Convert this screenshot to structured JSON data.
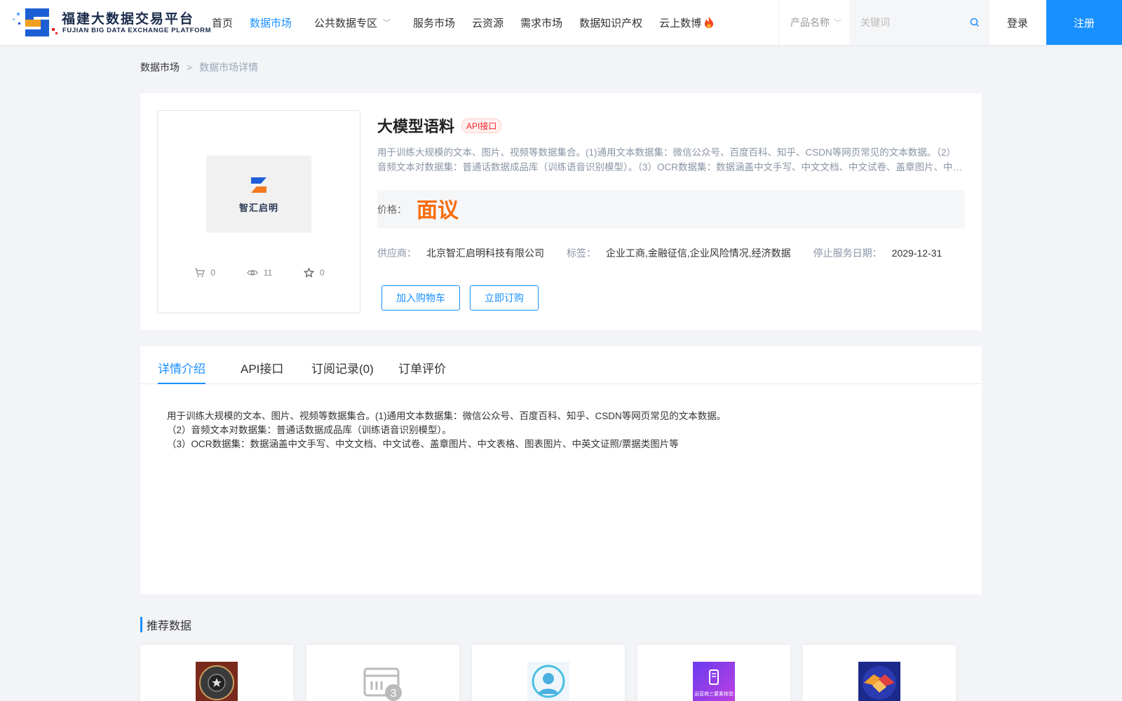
{
  "header": {
    "logo_cn": "福建大数据交易平台",
    "logo_en": "FUJIAN BIG DATA EXCHANGE  PLATFORM",
    "nav": [
      {
        "label": "首页"
      },
      {
        "label": "数据市场"
      },
      {
        "label": "公共数据专区"
      },
      {
        "label": "服务市场"
      },
      {
        "label": "云资源"
      },
      {
        "label": "需求市场"
      },
      {
        "label": "数据知识产权"
      },
      {
        "label": "云上数博"
      }
    ],
    "search_select": "产品名称",
    "search_placeholder": "关键词",
    "login": "登录",
    "register": "注册"
  },
  "breadcrumb": {
    "root": "数据市场",
    "sep": ">",
    "current": "数据市场详情"
  },
  "product": {
    "image_text": "智汇启明",
    "stats": {
      "cart": "0",
      "views": "11",
      "favorites": "0"
    },
    "title": "大模型语料",
    "tag": "API接口",
    "description": "用于训练大规模的文本、图片、视频等数据集合。(1)通用文本数据集：微信公众号、百度百科、知乎、CSDN等网页常见的文本数据。（2）音频文本对数据集：普通话数据成品库（训练语音识别模型）。（3）OCR数据集：数据涵盖中文手写、中文文档、中文试卷、盖章图片、中文表格、图表图片、中英文证照/票据类图片等",
    "price_label": "价格：",
    "price_value": "面议",
    "supplier_label": "供应商：",
    "supplier": "北京智汇启明科技有限公司",
    "tags_label": "标签：",
    "tags": "企业工商,金融征信,企业风险情况,经济数据",
    "stop_label": "停止服务日期：",
    "stop_date": "2029-12-31",
    "add_cart": "加入购物车",
    "buy_now": "立即订购"
  },
  "tabs": [
    {
      "label": "详情介绍"
    },
    {
      "label": "API接口"
    },
    {
      "label": "订阅记录(0)"
    },
    {
      "label": "订单评价"
    }
  ],
  "detail_text": "用于训练大规模的文本、图片、视频等数据集合。(1)通用文本数据集：微信公众号、百度百科、知乎、CSDN等网页常见的文本数据。\n（2）音频文本对数据集：普通话数据成品库（训练语音识别模型）。\n（3）OCR数据集：数据涵盖中文手写、中文文档、中文试卷、盖章图片、中文表格、图表图片、中英文证照/票据类图片等",
  "recommend_title": "推荐数据",
  "recommend_card_text": "运营商三要素核验",
  "colors": {
    "accent": "#1890ff",
    "price": "#fa6c0a",
    "tag": "#f5222d"
  }
}
